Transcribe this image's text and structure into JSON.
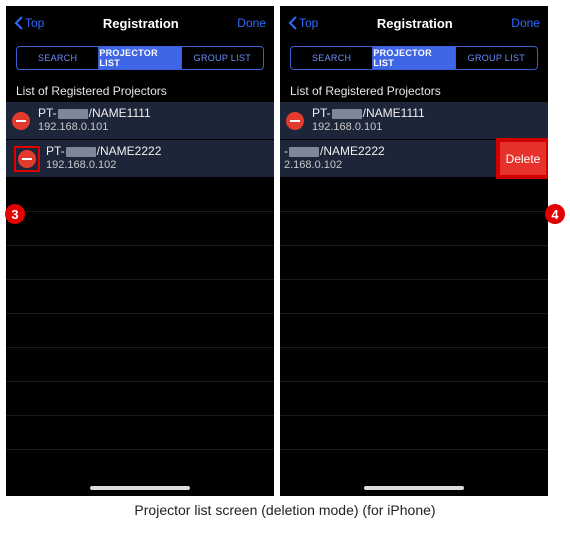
{
  "nav": {
    "back": "Top",
    "title": "Registration",
    "done": "Done"
  },
  "seg": {
    "search": "SEARCH",
    "list": "PROJECTOR LIST",
    "group": "GROUP LIST"
  },
  "section": "List of Registered Projectors",
  "p1": {
    "name_pre": "PT-",
    "name_post": "/NAME1111",
    "ip": "192.168.0.101"
  },
  "p2": {
    "name_pre": "PT-",
    "name_post": "/NAME2222",
    "ip": "192.168.0.102"
  },
  "p2_shift": {
    "name_post": "/NAME2222",
    "ip": "2.168.0.102"
  },
  "delete": "Delete",
  "callout3": "3",
  "callout4": "4",
  "caption": "Projector list screen (deletion mode) (for iPhone)"
}
